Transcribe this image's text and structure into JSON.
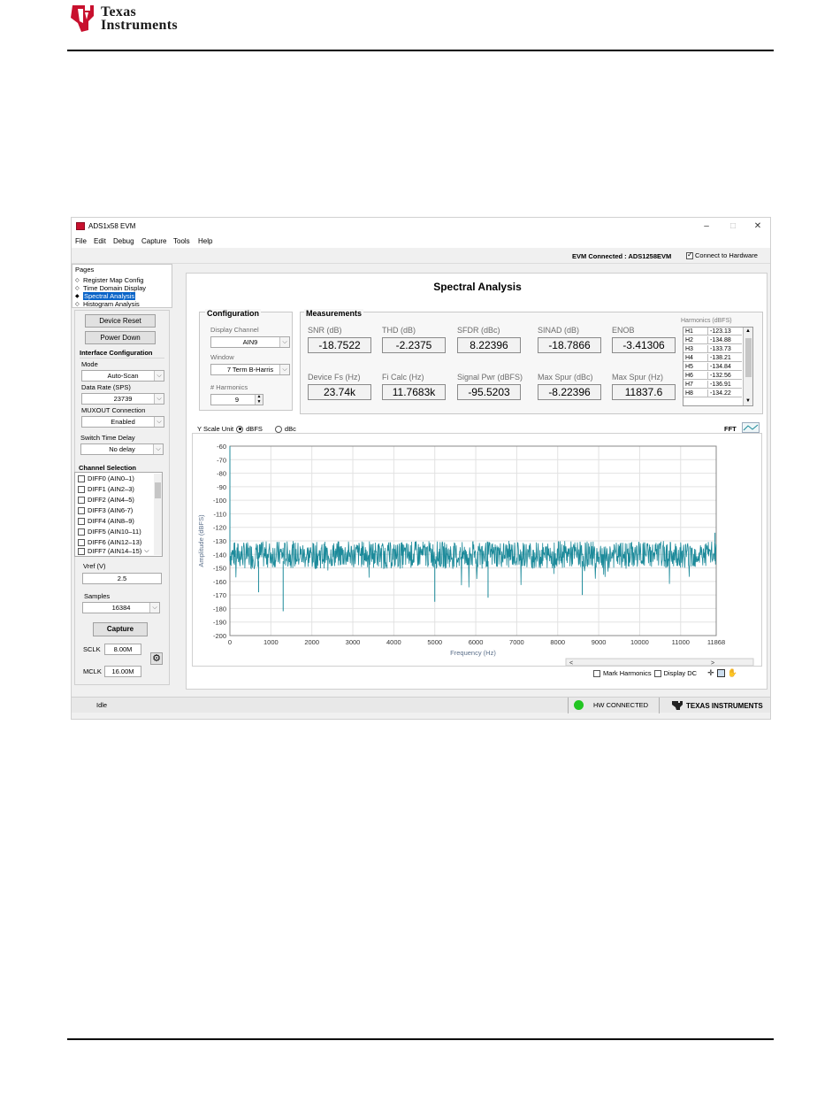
{
  "colors": {
    "ti_red": "#c8102e",
    "fft_trace": "#1c8a9a",
    "selection_blue": "#0a64c8",
    "hw_connected_green": "#22c522"
  },
  "document_header": {
    "brand_line1": "Texas",
    "brand_line2": "Instruments"
  },
  "window": {
    "title": "ADS1x58 EVM",
    "controls": [
      "–",
      "□",
      "✕"
    ]
  },
  "menu": [
    "File",
    "Edit",
    "Debug",
    "Capture",
    "Tools",
    "Help"
  ],
  "status_row": {
    "evm_connected": "EVM Connected : ADS1258EVM",
    "connect_hw_label": "Connect to Hardware"
  },
  "pages": {
    "title": "Pages",
    "items": [
      "Register Map Config",
      "Time Domain Display",
      "Spectral Analysis",
      "Histogram Analysis"
    ]
  },
  "left_panel": {
    "device_reset": "Device Reset",
    "power_down": "Power Down",
    "interface_config_title": "Interface Configuration",
    "mode_label": "Mode",
    "mode_value": "Auto-Scan",
    "data_rate_label": "Data Rate (SPS)",
    "data_rate_value": "23739",
    "muxout_label": "MUXOUT Connection",
    "muxout_value": "Enabled",
    "switch_delay_label": "Switch Time Delay",
    "switch_delay_value": "No delay",
    "channel_selection_title": "Channel Selection",
    "channels": [
      "DIFF0 (AIN0–1)",
      "DIFF1 (AIN2–3)",
      "DIFF2 (AIN4–5)",
      "DIFF3 (AIN6-7)",
      "DIFF4 (AIN8–9)",
      "DIFF5 (AIN10–11)",
      "DIFF6 (AIN12–13)",
      "DIFF7 (AIN14–15)"
    ],
    "vref_label": "Vref (V)",
    "vref_value": "2.5",
    "samples_label": "Samples",
    "samples_value": "16384",
    "capture_label": "Capture",
    "sclk_label": "SCLK",
    "sclk_value": "8.00M",
    "mclk_label": "MCLK",
    "mclk_value": "16.00M"
  },
  "main": {
    "title": "Spectral Analysis",
    "configuration": {
      "title": "Configuration",
      "display_channel_label": "Display Channel",
      "display_channel_value": "AIN9",
      "window_label": "Window",
      "window_value": "7 Term B-Harris",
      "harmonics_label": "# Harmonics",
      "harmonics_value": "9"
    },
    "measurements": {
      "title": "Measurements",
      "row1": [
        {
          "label": "SNR (dB)",
          "value": "-18.7522"
        },
        {
          "label": "THD (dB)",
          "value": "-2.2375"
        },
        {
          "label": "SFDR (dBc)",
          "value": "8.22396"
        },
        {
          "label": "SINAD (dB)",
          "value": "-18.7866"
        },
        {
          "label": "ENOB",
          "value": "-3.41306"
        }
      ],
      "row2": [
        {
          "label": "Device Fs (Hz)",
          "value": "23.74k"
        },
        {
          "label": "Fi Calc (Hz)",
          "value": "11.7683k"
        },
        {
          "label": "Signal Pwr (dBFS)",
          "value": "-95.5203"
        },
        {
          "label": "Max Spur (dBc)",
          "value": "-8.22396"
        },
        {
          "label": "Max Spur (Hz)",
          "value": "11837.6"
        }
      ]
    },
    "harmonics": {
      "title": "Harmonics (dBFS)",
      "rows": [
        {
          "h": "H1",
          "v": "-123.13"
        },
        {
          "h": "H2",
          "v": "-134.88"
        },
        {
          "h": "H3",
          "v": "-133.73"
        },
        {
          "h": "H4",
          "v": "-138.21"
        },
        {
          "h": "H5",
          "v": "-134.84"
        },
        {
          "h": "H6",
          "v": "-132.56"
        },
        {
          "h": "H7",
          "v": "-136.91"
        },
        {
          "h": "H8",
          "v": "-134.22"
        }
      ]
    },
    "y_scale": {
      "label": "Y Scale Unit",
      "option_dbfs": "dBFS",
      "option_dbc": "dBc"
    },
    "fft_label": "FFT",
    "mark_harmonics": "Mark Harmonics",
    "display_dc": "Display DC"
  },
  "status_bar": {
    "state": "Idle",
    "hw_status": "HW CONNECTED",
    "ti_brand": "Texas Instruments"
  },
  "chart_data": {
    "type": "line",
    "xlabel": "Frequency (Hz)",
    "ylabel": "Amplitude (dBFS)",
    "xlim": [
      0,
      11868
    ],
    "ylim": [
      -200,
      -60
    ],
    "x_ticks": [
      0,
      1000,
      2000,
      3000,
      4000,
      5000,
      6000,
      7000,
      8000,
      9000,
      10000,
      11000,
      11868
    ],
    "y_ticks": [
      -60,
      -70,
      -80,
      -90,
      -100,
      -110,
      -120,
      -130,
      -140,
      -150,
      -160,
      -170,
      -180,
      -190,
      -200
    ],
    "grid": true,
    "series": [
      {
        "description": "noise floor",
        "x": [
          0,
          500,
          1000,
          1500,
          2000,
          2500,
          3000,
          3500,
          4000,
          4500,
          5000,
          5500,
          6000,
          6500,
          7000,
          7500,
          8000,
          8500,
          9000,
          9500,
          10000,
          10500,
          11000,
          11868
        ],
        "y": [
          -140,
          -141,
          -140,
          -140,
          -141,
          -140,
          -140,
          -140,
          -141,
          -140,
          -140,
          -141,
          -140,
          -140,
          -140,
          -141,
          -140,
          -140,
          -140,
          -141,
          -140,
          -140,
          -140,
          -140
        ],
        "band_low": -150,
        "band_high": -130
      }
    ],
    "spurs": [
      {
        "x": 0,
        "y": -60
      },
      {
        "x": 1300,
        "y": -182
      },
      {
        "x": 700,
        "y": -168
      },
      {
        "x": 5000,
        "y": -175
      },
      {
        "x": 6300,
        "y": -172
      },
      {
        "x": 8600,
        "y": -170
      },
      {
        "x": 11838,
        "y": -124
      }
    ]
  }
}
